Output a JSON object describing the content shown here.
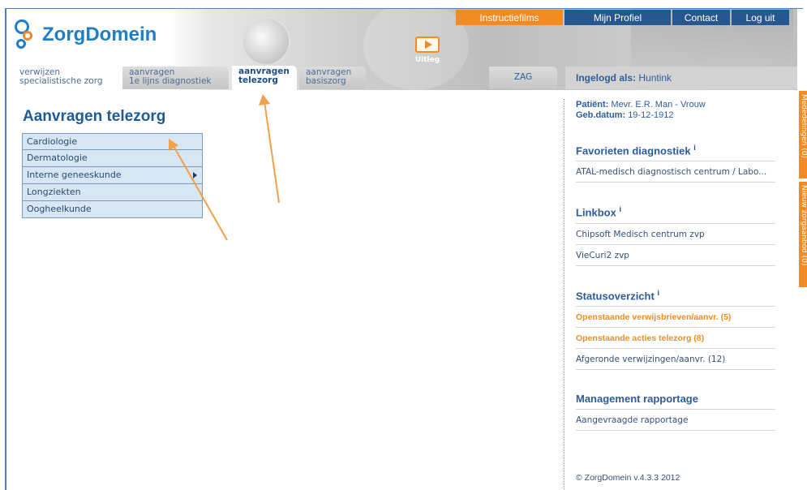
{
  "header": {
    "logo_text": "ZorgDomein",
    "uitleg_label": "Uitleg"
  },
  "topnav": {
    "instructiefilms": "Instructiefilms",
    "mijn_profiel": "Mijn Profiel",
    "contact": "Contact",
    "log_uit": "Log uit"
  },
  "tabs": [
    {
      "line1": "verwijzen",
      "line2": "specialistische zorg"
    },
    {
      "line1": "aanvragen",
      "line2": "1e lijns diagnostiek"
    },
    {
      "line1": "aanvragen",
      "line2": "telezorg"
    },
    {
      "line1": "aanvragen",
      "line2": "basiszorg"
    }
  ],
  "zag_tab": "ZAG",
  "login": {
    "label": "Ingelogd als:",
    "user": "Huntink"
  },
  "main": {
    "title": "Aanvragen telezorg",
    "menu": [
      "Cardiologie",
      "Dermatologie",
      "Interne geneeskunde",
      "Longziekten",
      "Oogheelkunde"
    ]
  },
  "patient": {
    "label": "Patiënt:",
    "name": "Mevr. E.R. Man - Vrouw",
    "dob_label": "Geb.datum:",
    "dob": "19-12-1912"
  },
  "favorieten": {
    "title": "Favorieten diagnostiek",
    "info": "i",
    "items": [
      "ATAL-medisch diagnostisch centrum / Labo..."
    ]
  },
  "linkbox": {
    "title": "Linkbox",
    "info": "i",
    "items": [
      "Chipsoft Medisch centrum zvp",
      "VieCuri2 zvp"
    ]
  },
  "status": {
    "title": "Statusoverzicht",
    "info": "i",
    "items": [
      "Openstaande verwijsbrieven/aanvr. (5)",
      "Openstaande acties telezorg (8)",
      "Afgeronde verwijzingen/aanvr. (12)"
    ]
  },
  "management": {
    "title": "Management rapportage",
    "items": [
      "Aangevraagde rapportage"
    ]
  },
  "copyright": "© ZorgDomein v.4.3.3 2012",
  "sidetabs": [
    "Mededelingen (0)",
    "Nieuw zorgaanbod (0)"
  ],
  "colors": {
    "accent_orange": "#f28b24",
    "nav_blue": "#27578f",
    "menu_bg": "#d6e6f2"
  }
}
